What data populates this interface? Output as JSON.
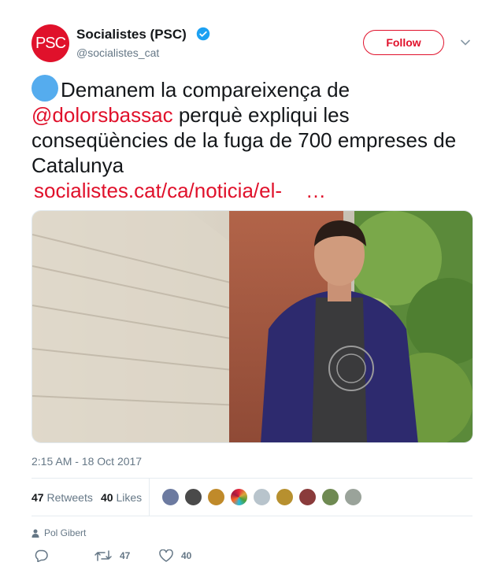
{
  "author": {
    "avatar_text": "PSC",
    "name": "Socialistes (PSC)",
    "handle": "@socialistes_cat",
    "follow_label": "Follow"
  },
  "tweet": {
    "text_part1": "Demanem la compareixença de ",
    "mention": "@dolorsbassac",
    "text_part2": " perquè expliqui les conseqüències de la fuga de 700 empreses de Catalunya",
    "link": "socialistes.cat/ca/noticia/el-",
    "link_ellipsis": "…",
    "timestamp": "2:15 AM - 18 Oct 2017"
  },
  "stats": {
    "retweets_count": "47",
    "retweets_label": "Retweets",
    "likes_count": "40",
    "likes_label": "Likes"
  },
  "context": {
    "person": "Pol Gibert"
  },
  "actions": {
    "retweet_count": "47",
    "like_count": "40"
  },
  "colors": {
    "brand": "#e0112b",
    "verified": "#1da1f2",
    "muted": "#657786"
  }
}
